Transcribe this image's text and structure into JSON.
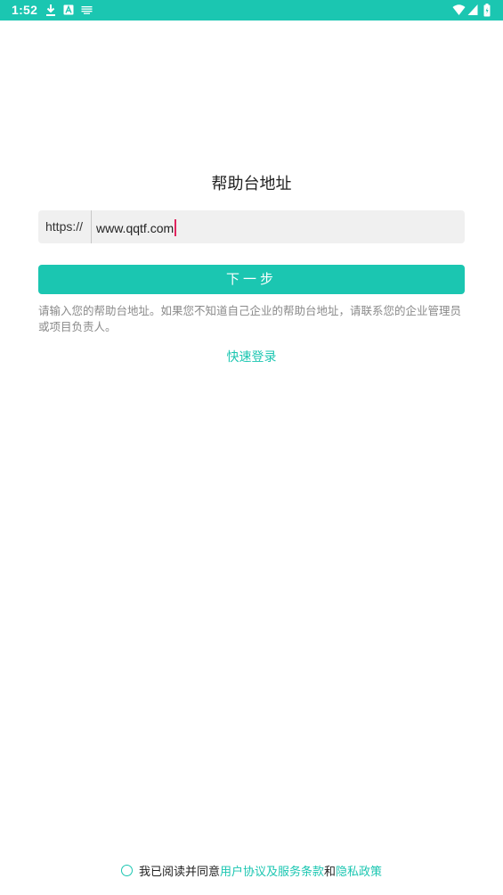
{
  "status_bar": {
    "time": "1:52",
    "color": "#1bc6b1",
    "left_icons": [
      "download-icon",
      "a-app-icon",
      "notification-icon"
    ],
    "right_icons": [
      "wifi-icon",
      "cellular-signal-icon",
      "battery-icon"
    ]
  },
  "page": {
    "title": "帮助台地址"
  },
  "url_input": {
    "prefix": "https://",
    "value": "www.qqtf.com"
  },
  "next_button": {
    "label": "下一步"
  },
  "hint": {
    "text": "请输入您的帮助台地址。如果您不知道自己企业的帮助台地址，请联系您的企业管理员或项目负责人。"
  },
  "quick_login": {
    "label": "快速登录"
  },
  "agreement": {
    "prefix": "我已阅读并同意",
    "terms_link": "用户协议及服务条款",
    "conjunction": "和",
    "privacy_link": "隐私政策",
    "checked": false
  },
  "colors": {
    "accent": "#1bc6b1",
    "caret": "#e0245e",
    "hint_text": "#8a8a8a"
  }
}
